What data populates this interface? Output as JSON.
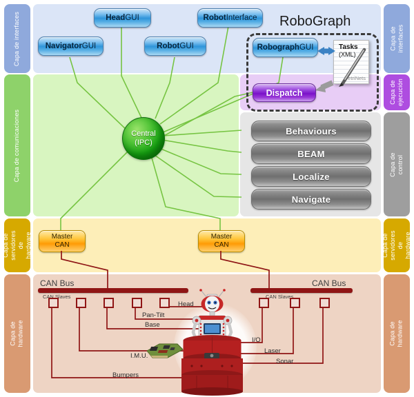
{
  "diagram": {
    "title": "RoboGraph"
  },
  "rails_left": [
    {
      "label": "Capa de interfaces"
    },
    {
      "label": "Capa de comunicaciones"
    },
    {
      "label": "Capa de servidores de hardware"
    },
    {
      "label": "Capa de hardware"
    }
  ],
  "rails_right": [
    {
      "label": "Capa de interfaces"
    },
    {
      "label": "Capa de ejecución"
    },
    {
      "label": "Capa de control"
    },
    {
      "label": "Capa de servidores de hardware"
    },
    {
      "label": "Capa de hardware"
    }
  ],
  "interfaces": {
    "buttons": [
      {
        "bold": "Head",
        "normal": "GUI"
      },
      {
        "bold": "Navigator",
        "normal": "GUI"
      },
      {
        "bold": "Robot",
        "normal": "GUI"
      },
      {
        "bold": "Robot",
        "normal": "Interface"
      },
      {
        "bold": "Robograph",
        "normal": "GUI"
      }
    ]
  },
  "execution": {
    "dispatch_label": "Dispatch",
    "tasks": {
      "title": "Tasks",
      "subtitle": "(XML)",
      "footer": "PetriNets"
    }
  },
  "communications": {
    "central_line1": "Central",
    "central_line2": "(IPC)"
  },
  "control": {
    "modules": [
      {
        "label": "Behaviours"
      },
      {
        "label": "BEAM"
      },
      {
        "label": "Localize"
      },
      {
        "label": "Navigate"
      }
    ]
  },
  "hardware_servers": {
    "masters": [
      {
        "line1": "Master",
        "line2": "CAN"
      },
      {
        "line1": "Master",
        "line2": "CAN"
      }
    ]
  },
  "hardware": {
    "bus_left": {
      "bus_label": "CAN Bus",
      "slaves_label": "CAN Slaves",
      "devices": [
        {
          "label": "Head"
        },
        {
          "label": "Pan-Tilt"
        },
        {
          "label": "Base"
        },
        {
          "label": "I.M.U."
        },
        {
          "label": "Bumpers"
        }
      ]
    },
    "bus_right": {
      "bus_label": "CAN Bus",
      "slaves_label": "CAN Slaves",
      "devices": [
        {
          "label": "I/O"
        },
        {
          "label": "Laser"
        },
        {
          "label": "Sonar"
        }
      ]
    }
  },
  "colors": {
    "interfaces": "#dbe5f7",
    "communications": "#d8f5c0",
    "execution": "#e8cdf6",
    "control": "#e6e6e6",
    "hardware_servers": "#fdeeb8",
    "hardware": "#eed4c4",
    "link_green": "#76c442",
    "bus_red": "#8f1515"
  }
}
